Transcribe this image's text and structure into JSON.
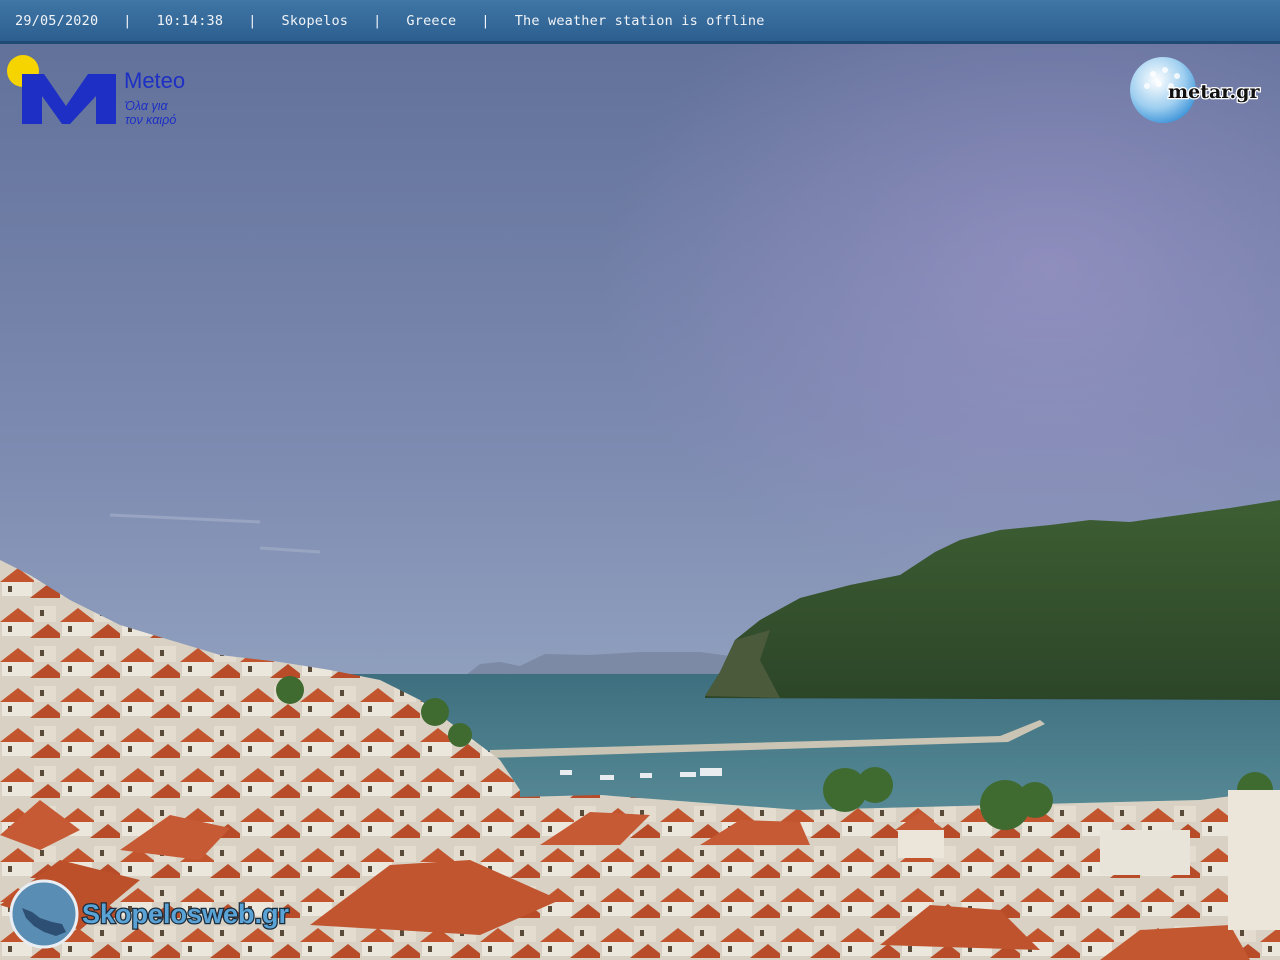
{
  "header": {
    "date": "29/05/2020",
    "time": "10:14:38",
    "location": "Skopelos",
    "country": "Greece",
    "status": "The weather station is offline",
    "separator": "|"
  },
  "logos": {
    "meteo": {
      "name": "Meteo",
      "tagline_line1": "Όλα για",
      "tagline_line2": "τον καιρό"
    },
    "metar": {
      "name": "metar.gr"
    },
    "skopelosweb": {
      "name": "Skopelosweb.gr"
    }
  },
  "colors": {
    "header_bg": "#356a9b",
    "meteo_blue": "#1d2fc4",
    "sun_yellow": "#f5d400",
    "sea": "#4d7e8c",
    "roof": "#c65a35"
  }
}
